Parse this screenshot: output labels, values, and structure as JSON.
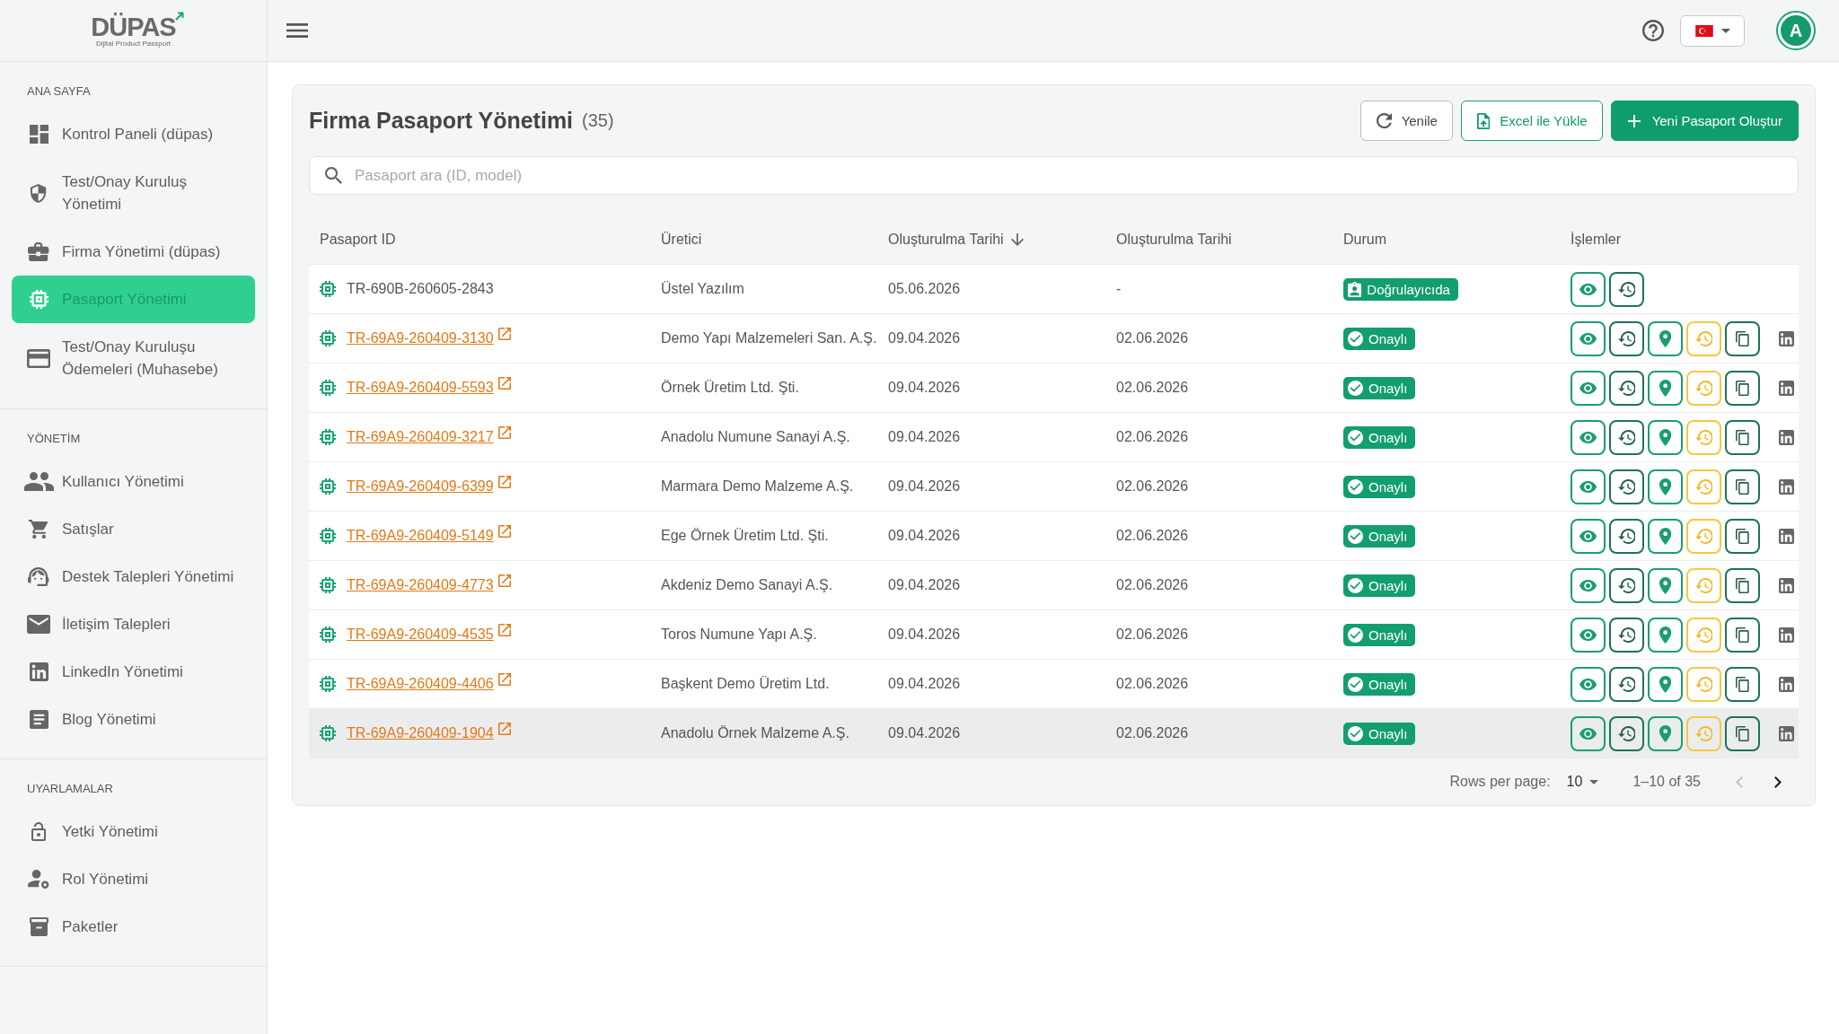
{
  "sidebar": {
    "logo": {
      "name": "DÜPAS",
      "tagline": "Dijital Product Passport"
    },
    "sections": [
      {
        "title": "ANA SAYFA",
        "items": [
          {
            "label": "Kontrol Paneli (düpas)",
            "selected": false
          },
          {
            "label": "Test/Onay Kuruluş Yönetimi",
            "selected": false
          },
          {
            "label": "Firma Yönetimi (düpas)",
            "selected": false
          },
          {
            "label": "Pasaport Yönetimi",
            "selected": true
          },
          {
            "label": "Test/Onay Kuruluşu Ödemeleri (Muhasebe)",
            "selected": false
          }
        ]
      },
      {
        "title": "YÖNETİM",
        "items": [
          {
            "label": "Kullanıcı Yönetimi",
            "selected": false
          },
          {
            "label": "Satışlar",
            "selected": false
          },
          {
            "label": "Destek Talepleri Yönetimi",
            "selected": false
          },
          {
            "label": "İletişim Talepleri",
            "selected": false
          },
          {
            "label": "LinkedIn Yönetimi",
            "selected": false
          },
          {
            "label": "Blog Yönetimi",
            "selected": false
          }
        ]
      },
      {
        "title": "UYARLAMALAR",
        "items": [
          {
            "label": "Yetki Yönetimi",
            "selected": false
          },
          {
            "label": "Rol Yönetimi",
            "selected": false
          },
          {
            "label": "Paketler",
            "selected": false
          }
        ]
      }
    ]
  },
  "topbar": {
    "avatar_initial": "A"
  },
  "page": {
    "title": "Firma Pasaport Yönetimi",
    "count": "(35)",
    "buttons": [
      {
        "label": "Yenile",
        "kind": "outline"
      },
      {
        "label": "Excel ile Yükle",
        "kind": "accent"
      },
      {
        "label": "Yeni Pasaport Oluştur",
        "kind": "primary"
      }
    ],
    "search": {
      "placeholder": "Pasaport ara (ID, model)"
    }
  },
  "table": {
    "columns": [
      {
        "label": "Pasaport ID",
        "sorted": false
      },
      {
        "label": "Üretici",
        "sorted": false
      },
      {
        "label": "Oluşturulma Tarihi",
        "sorted": true
      },
      {
        "label": "Oluşturulma Tarihi",
        "sorted": false
      },
      {
        "label": "Durum",
        "sorted": false
      },
      {
        "label": "İşlemler",
        "sorted": false
      }
    ],
    "rows": [
      {
        "id": "TR-690B-260605-2843",
        "linked": false,
        "manufacturer": "Üstel Yazılım",
        "date_1": "05.06.2026",
        "date_2": "-",
        "status": {
          "label": "Doğrulayıcıda",
          "kind": "verifier"
        },
        "actions": [
          {
            "kind": "view"
          },
          {
            "kind": "history"
          }
        ],
        "highlighted": false
      },
      {
        "id": "TR-69A9-260409-3130",
        "linked": true,
        "manufacturer": "Demo Yapı Malzemeleri San. A.Ş.",
        "date_1": "09.04.2026",
        "date_2": "02.06.2026",
        "status": {
          "label": "Onaylı",
          "kind": "approved"
        },
        "actions": [
          {
            "kind": "view"
          },
          {
            "kind": "history"
          },
          {
            "kind": "location"
          },
          {
            "kind": "restore"
          },
          {
            "kind": "copy"
          },
          {
            "kind": "linkedin"
          }
        ],
        "highlighted": false
      },
      {
        "id": "TR-69A9-260409-5593",
        "linked": true,
        "manufacturer": "Örnek Üretim Ltd. Şti.",
        "date_1": "09.04.2026",
        "date_2": "02.06.2026",
        "status": {
          "label": "Onaylı",
          "kind": "approved"
        },
        "actions": [
          {
            "kind": "view"
          },
          {
            "kind": "history"
          },
          {
            "kind": "location"
          },
          {
            "kind": "restore"
          },
          {
            "kind": "copy"
          },
          {
            "kind": "linkedin"
          }
        ],
        "highlighted": false
      },
      {
        "id": "TR-69A9-260409-3217",
        "linked": true,
        "manufacturer": "Anadolu Numune Sanayi A.Ş.",
        "date_1": "09.04.2026",
        "date_2": "02.06.2026",
        "status": {
          "label": "Onaylı",
          "kind": "approved"
        },
        "actions": [
          {
            "kind": "view"
          },
          {
            "kind": "history"
          },
          {
            "kind": "location"
          },
          {
            "kind": "restore"
          },
          {
            "kind": "copy"
          },
          {
            "kind": "linkedin"
          }
        ],
        "highlighted": false
      },
      {
        "id": "TR-69A9-260409-6399",
        "linked": true,
        "manufacturer": "Marmara Demo Malzeme A.Ş.",
        "date_1": "09.04.2026",
        "date_2": "02.06.2026",
        "status": {
          "label": "Onaylı",
          "kind": "approved"
        },
        "actions": [
          {
            "kind": "view"
          },
          {
            "kind": "history"
          },
          {
            "kind": "location"
          },
          {
            "kind": "restore"
          },
          {
            "kind": "copy"
          },
          {
            "kind": "linkedin"
          }
        ],
        "highlighted": false
      },
      {
        "id": "TR-69A9-260409-5149",
        "linked": true,
        "manufacturer": "Ege Örnek Üretim Ltd. Şti.",
        "date_1": "09.04.2026",
        "date_2": "02.06.2026",
        "status": {
          "label": "Onaylı",
          "kind": "approved"
        },
        "actions": [
          {
            "kind": "view"
          },
          {
            "kind": "history"
          },
          {
            "kind": "location"
          },
          {
            "kind": "restore"
          },
          {
            "kind": "copy"
          },
          {
            "kind": "linkedin"
          }
        ],
        "highlighted": false
      },
      {
        "id": "TR-69A9-260409-4773",
        "linked": true,
        "manufacturer": "Akdeniz Demo Sanayi A.Ş.",
        "date_1": "09.04.2026",
        "date_2": "02.06.2026",
        "status": {
          "label": "Onaylı",
          "kind": "approved"
        },
        "actions": [
          {
            "kind": "view"
          },
          {
            "kind": "history"
          },
          {
            "kind": "location"
          },
          {
            "kind": "restore"
          },
          {
            "kind": "copy"
          },
          {
            "kind": "linkedin"
          }
        ],
        "highlighted": false
      },
      {
        "id": "TR-69A9-260409-4535",
        "linked": true,
        "manufacturer": "Toros Numune Yapı A.Ş.",
        "date_1": "09.04.2026",
        "date_2": "02.06.2026",
        "status": {
          "label": "Onaylı",
          "kind": "approved"
        },
        "actions": [
          {
            "kind": "view"
          },
          {
            "kind": "history"
          },
          {
            "kind": "location"
          },
          {
            "kind": "restore"
          },
          {
            "kind": "copy"
          },
          {
            "kind": "linkedin"
          }
        ],
        "highlighted": false
      },
      {
        "id": "TR-69A9-260409-4406",
        "linked": true,
        "manufacturer": "Başkent Demo Üretim Ltd.",
        "date_1": "09.04.2026",
        "date_2": "02.06.2026",
        "status": {
          "label": "Onaylı",
          "kind": "approved"
        },
        "actions": [
          {
            "kind": "view"
          },
          {
            "kind": "history"
          },
          {
            "kind": "location"
          },
          {
            "kind": "restore"
          },
          {
            "kind": "copy"
          },
          {
            "kind": "linkedin"
          }
        ],
        "highlighted": false
      },
      {
        "id": "TR-69A9-260409-1904",
        "linked": true,
        "manufacturer": "Anadolu Örnek Malzeme A.Ş.",
        "date_1": "09.04.2026",
        "date_2": "02.06.2026",
        "status": {
          "label": "Onaylı",
          "kind": "approved"
        },
        "actions": [
          {
            "kind": "view"
          },
          {
            "kind": "history"
          },
          {
            "kind": "location"
          },
          {
            "kind": "restore"
          },
          {
            "kind": "copy"
          },
          {
            "kind": "linkedin"
          }
        ],
        "highlighted": true
      }
    ],
    "pagination": {
      "rows_per_page_label": "Rows per page:",
      "rows_per_page": "10",
      "range": "1–10 of 35",
      "prev_disabled": true,
      "next_disabled": false
    }
  }
}
